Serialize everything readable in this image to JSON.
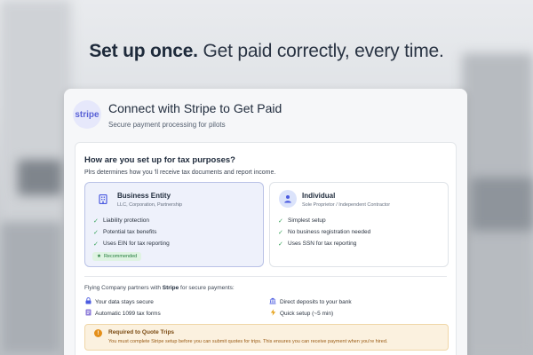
{
  "headline": {
    "bold": "Set up once.",
    "rest": "Get paid correctly, every time."
  },
  "card": {
    "logo_text": "stripe",
    "title": "Connect with Stripe to Get Paid",
    "subtitle": "Secure payment processing for pilots"
  },
  "tax": {
    "question": "How are you set up for tax purposes?",
    "description": "Plrs determines how you 'll receive tax documents and report income."
  },
  "options": [
    {
      "title": "Business Entity",
      "desc": "LLC, Corporation, Partnership",
      "icon": "building-icon",
      "selected": true,
      "items": [
        "Liability protection",
        "Potential tax benefits",
        "Uses EIN for tax reporting"
      ],
      "badge": "Recommended"
    },
    {
      "title": "Individual",
      "desc": "Sole Proprietor / Independent Contractor",
      "icon": "person-icon",
      "selected": false,
      "items": [
        "Simplest setup",
        "No business registration needed",
        "Uses SSN for tax reporting"
      ]
    }
  ],
  "partner": {
    "prefix": "Flying Company partners with",
    "brand": "Stripe",
    "suffix": "for secure payments:"
  },
  "features": [
    {
      "icon": "lock-icon",
      "label": "Your data stays secure"
    },
    {
      "icon": "bank-icon",
      "label": "Direct deposits to your bank"
    },
    {
      "icon": "document-icon",
      "label": "Automatic 1099 tax forms"
    },
    {
      "icon": "bolt-icon",
      "label": "Quick setup (~5 min)"
    }
  ],
  "notice": {
    "title": "Required to Quote Trips",
    "text": "You must complete Stripe setup before you can submit quotes for trips. This ensures you can receive payment when you're hired."
  },
  "colors": {
    "accent": "#4b5be0",
    "success": "#3aa55d",
    "warning": "#e48f1a"
  }
}
